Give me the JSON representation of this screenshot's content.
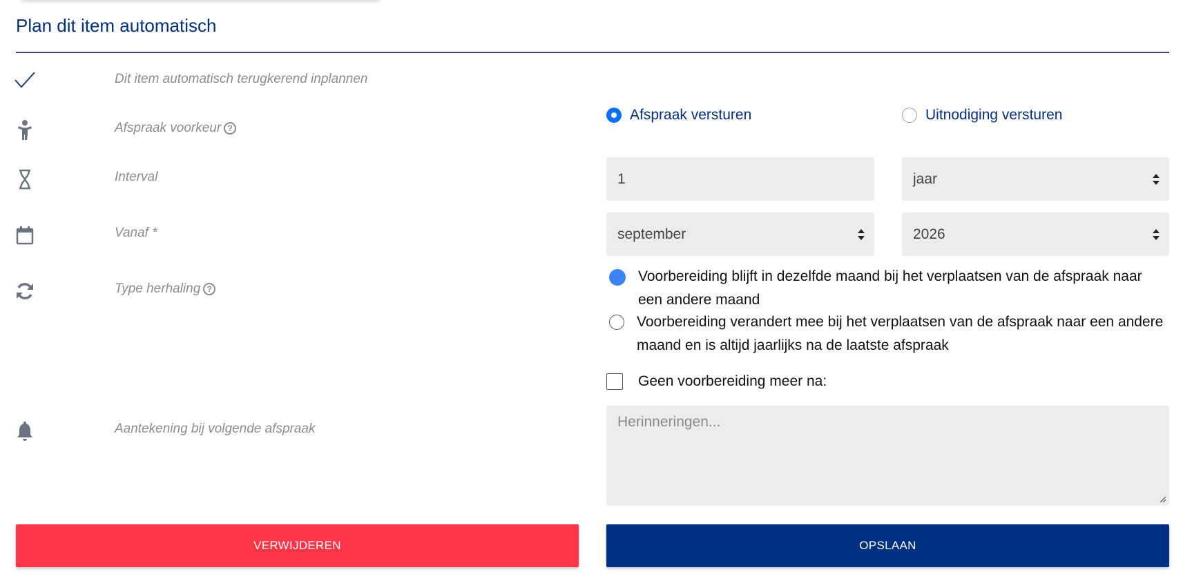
{
  "form": {
    "title": "Plan dit item automatisch"
  },
  "rows": {
    "auto": {
      "icon": "checkmark-icon",
      "label": "Dit item automatisch terugkerend inplannen"
    },
    "preference": {
      "icon": "person-icon",
      "label": "Afspraak voorkeur"
    },
    "interval": {
      "icon": "hourglass-icon",
      "label": "Interval"
    },
    "from": {
      "icon": "calendar-icon",
      "label": "Vanaf *"
    },
    "repeat_type": {
      "icon": "refresh-icon",
      "label": "Type herhaling"
    },
    "note": {
      "icon": "bell-icon",
      "label": "Aantekening bij volgende afspraak"
    }
  },
  "preference_options": [
    {
      "label": "Afspraak versturen",
      "selected": true
    },
    {
      "label": "Uitnodiging versturen",
      "selected": false
    }
  ],
  "interval": {
    "value": "1",
    "unit": "jaar"
  },
  "from": {
    "month": "september",
    "year": "2026"
  },
  "repeat_options": [
    {
      "label": "Voorbereiding blijft in dezelfde maand bij het verplaatsen van de afspraak naar een andere maand",
      "selected": true
    },
    {
      "label": "Voorbereiding verandert mee bij het verplaatsen van de afspraak naar een andere maand en is altijd jaarlijks na de laatste afspraak",
      "selected": false
    }
  ],
  "no_more_prep": {
    "label": "Geen voorbereiding meer na:",
    "checked": false
  },
  "note_field": {
    "placeholder": "Herinneringen..."
  },
  "buttons": {
    "delete": "VERWIJDEREN",
    "save": "OPSLAAN"
  },
  "colors": {
    "primary": "#003082",
    "danger": "#ff3447",
    "radio_accent": "#0d6efd",
    "field_bg": "#ececec"
  }
}
